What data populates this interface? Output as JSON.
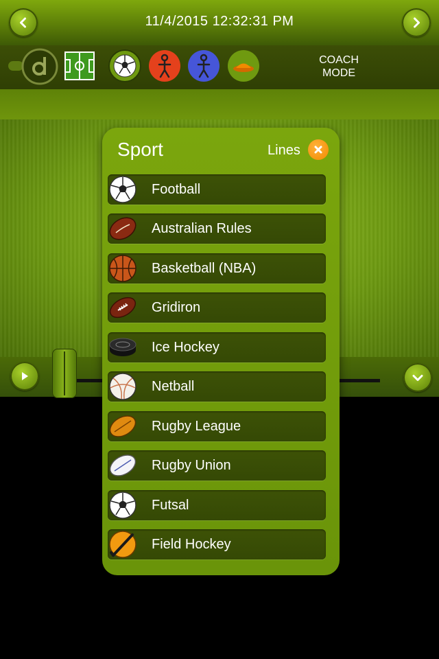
{
  "header": {
    "datetime": "11/4/2015 12:32:31 PM"
  },
  "toolbar": {
    "coach_mode_line1": "COACH",
    "coach_mode_line2": "MODE"
  },
  "popup": {
    "title": "Sport",
    "lines_label": "Lines",
    "items": [
      {
        "label": "Football",
        "icon": "soccer-ball-icon"
      },
      {
        "label": "Australian Rules",
        "icon": "aussie-rules-ball-icon"
      },
      {
        "label": "Basketball (NBA)",
        "icon": "basketball-icon"
      },
      {
        "label": "Gridiron",
        "icon": "american-football-icon"
      },
      {
        "label": "Ice Hockey",
        "icon": "hockey-puck-icon"
      },
      {
        "label": "Netball",
        "icon": "netball-icon"
      },
      {
        "label": "Rugby League",
        "icon": "rugby-league-ball-icon"
      },
      {
        "label": "Rugby Union",
        "icon": "rugby-union-ball-icon"
      },
      {
        "label": "Futsal",
        "icon": "futsal-ball-icon"
      },
      {
        "label": "Field Hockey",
        "icon": "field-hockey-icon"
      }
    ]
  },
  "colors": {
    "accent": "#7ba60d",
    "close": "#f28a00",
    "player_red": "#e4411c",
    "player_blue": "#4656d8",
    "cone": "#f28a00"
  }
}
